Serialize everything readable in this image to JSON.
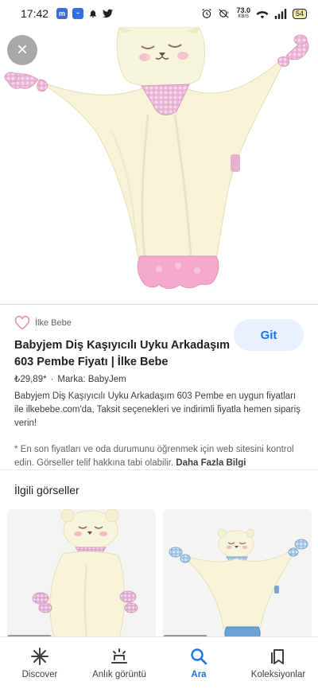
{
  "status_bar": {
    "time": "17:42",
    "net_speed_value": "73.0",
    "net_speed_unit": "KB/S",
    "battery": "54"
  },
  "hero": {
    "close_label": "×"
  },
  "result": {
    "source_name": "İlke Bebe",
    "visit_label": "Git",
    "title": "Babyjem Diş Kaşıyıcılı Uyku Arkadaşım 603 Pembe Fiyatı | İlke Bebe",
    "price": "₺29,89*",
    "separator": "·",
    "brand": "Marka: BabyJem",
    "description": "Babyjem Diş Kaşıyıcılı Uyku Arkadaşım 603 Pembe en uygun fiyatları ile ilkebebe.com'da, Taksit seçenekleri ve indirimli fiyatla hemen sipariş verin!",
    "note_text": "* En son fiyatları ve oda durumunu öğrenmek için web sitesini kontrol edin. Görseller telif hakkına tabi olabilir. ",
    "note_link": "Daha Fazla Bilgi"
  },
  "related": {
    "title": "İlgili görseller"
  },
  "bottom_nav": {
    "items": [
      {
        "label": "Discover",
        "icon": "asterisk-icon"
      },
      {
        "label": "Anlık görüntü",
        "icon": "snapshot-icon"
      },
      {
        "label": "Ara",
        "icon": "search-icon"
      },
      {
        "label": "Koleksiyonlar",
        "icon": "bookmark-icon"
      }
    ],
    "active": "Ara"
  },
  "colors": {
    "accent": "#1a73e8",
    "toy_cream": "#f6f3d6",
    "toy_pink": "#f2a6c8",
    "gingham": "#e7b3d3"
  }
}
